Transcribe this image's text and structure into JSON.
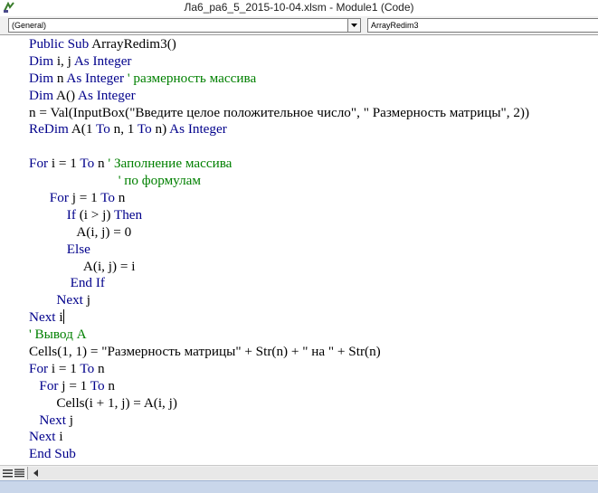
{
  "window": {
    "title": "Ла6_ра6_5_2015-10-04.xlsm - Module1 (Code)",
    "icon": "vba-module-icon"
  },
  "toolbar": {
    "object_combo": "(General)",
    "procedure_combo": "ArrayRedim3"
  },
  "code": {
    "lines": [
      {
        "indent": "",
        "parts": [
          {
            "t": "Public Sub",
            "c": "kw"
          },
          {
            "t": " ArrayRedim3()",
            "c": ""
          }
        ]
      },
      {
        "indent": "",
        "parts": [
          {
            "t": "Dim",
            "c": "kw"
          },
          {
            "t": " i, j ",
            "c": ""
          },
          {
            "t": "As Integer",
            "c": "kw"
          }
        ]
      },
      {
        "indent": "",
        "parts": [
          {
            "t": "Dim",
            "c": "kw"
          },
          {
            "t": " n ",
            "c": ""
          },
          {
            "t": "As Integer",
            "c": "kw"
          },
          {
            "t": " ' размерность массива",
            "c": "cm"
          }
        ]
      },
      {
        "indent": "",
        "parts": [
          {
            "t": "Dim",
            "c": "kw"
          },
          {
            "t": " A() ",
            "c": ""
          },
          {
            "t": "As Integer",
            "c": "kw"
          }
        ]
      },
      {
        "indent": "",
        "parts": [
          {
            "t": "n = Val(InputBox(\"Введите целое положительное число\", \" Размерность матрицы\", 2))",
            "c": ""
          }
        ]
      },
      {
        "indent": "",
        "parts": [
          {
            "t": "ReDim",
            "c": "kw"
          },
          {
            "t": " A(1 ",
            "c": ""
          },
          {
            "t": "To",
            "c": "kw"
          },
          {
            "t": " n, 1 ",
            "c": ""
          },
          {
            "t": "To",
            "c": "kw"
          },
          {
            "t": " n) ",
            "c": ""
          },
          {
            "t": "As Integer",
            "c": "kw"
          }
        ]
      },
      {
        "indent": "",
        "parts": []
      },
      {
        "indent": "",
        "parts": [
          {
            "t": "For",
            "c": "kw"
          },
          {
            "t": " i = 1 ",
            "c": ""
          },
          {
            "t": "To",
            "c": "kw"
          },
          {
            "t": " n ",
            "c": ""
          },
          {
            "t": "' Заполнение массива",
            "c": "cm"
          }
        ]
      },
      {
        "indent": "                          ",
        "parts": [
          {
            "t": "' по формулам",
            "c": "cm"
          }
        ]
      },
      {
        "indent": "      ",
        "parts": [
          {
            "t": "For",
            "c": "kw"
          },
          {
            "t": " j = 1 ",
            "c": ""
          },
          {
            "t": "To",
            "c": "kw"
          },
          {
            "t": " n",
            "c": ""
          }
        ]
      },
      {
        "indent": "           ",
        "parts": [
          {
            "t": "If",
            "c": "kw"
          },
          {
            "t": " (i > j) ",
            "c": ""
          },
          {
            "t": "Then",
            "c": "kw"
          }
        ]
      },
      {
        "indent": "              ",
        "parts": [
          {
            "t": "A(i, j) = 0",
            "c": ""
          }
        ]
      },
      {
        "indent": "           ",
        "parts": [
          {
            "t": "Else",
            "c": "kw"
          }
        ]
      },
      {
        "indent": "                ",
        "parts": [
          {
            "t": "A(i, j) = i",
            "c": ""
          }
        ]
      },
      {
        "indent": "            ",
        "parts": [
          {
            "t": "End If",
            "c": "kw"
          }
        ]
      },
      {
        "indent": "        ",
        "parts": [
          {
            "t": "Next",
            "c": "kw"
          },
          {
            "t": " j",
            "c": ""
          }
        ]
      },
      {
        "indent": "",
        "parts": [
          {
            "t": "Next",
            "c": "kw"
          },
          {
            "t": " i",
            "c": ""
          }
        ],
        "caret": true
      },
      {
        "indent": "",
        "parts": [
          {
            "t": "' Вывод А",
            "c": "cm"
          }
        ]
      },
      {
        "indent": "",
        "parts": [
          {
            "t": "Cells(1, 1) = \"Размерность матрицы\" + Str(n) + \" на \" + Str(n)",
            "c": ""
          }
        ]
      },
      {
        "indent": "",
        "parts": [
          {
            "t": "For",
            "c": "kw"
          },
          {
            "t": " i = 1 ",
            "c": ""
          },
          {
            "t": "To",
            "c": "kw"
          },
          {
            "t": " n",
            "c": ""
          }
        ]
      },
      {
        "indent": "   ",
        "parts": [
          {
            "t": "For",
            "c": "kw"
          },
          {
            "t": " j = 1 ",
            "c": ""
          },
          {
            "t": "To",
            "c": "kw"
          },
          {
            "t": " n",
            "c": ""
          }
        ]
      },
      {
        "indent": "        ",
        "parts": [
          {
            "t": "Cells(i + 1, j) = A(i, j)",
            "c": ""
          }
        ]
      },
      {
        "indent": "   ",
        "parts": [
          {
            "t": "Next",
            "c": "kw"
          },
          {
            "t": " j",
            "c": ""
          }
        ]
      },
      {
        "indent": "",
        "parts": [
          {
            "t": "Next",
            "c": "kw"
          },
          {
            "t": " i",
            "c": ""
          }
        ]
      },
      {
        "indent": "",
        "parts": [
          {
            "t": "End Sub",
            "c": "kw"
          }
        ]
      }
    ]
  },
  "colors": {
    "keyword": "#00008b",
    "comment": "#008000",
    "text": "#000000"
  },
  "statusbar": {
    "procedure_view_icon": "procedure-view-icon",
    "module_view_icon": "full-module-view-icon",
    "scroll_left_icon": "scroll-left-arrow-icon"
  }
}
